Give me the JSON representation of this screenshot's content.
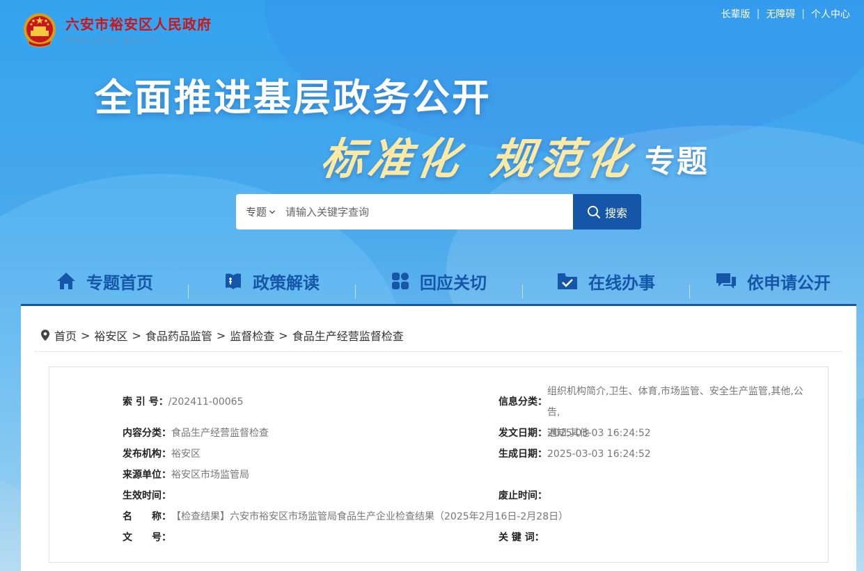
{
  "header": {
    "site_title": "六安市裕安区人民政府",
    "site_url": "www.yuan.gov.cn",
    "links": [
      "长辈版",
      "无障碍",
      "个人中心"
    ],
    "separator": "|"
  },
  "banner": {
    "headline": "全面推进基层政务公开",
    "calligraphy_1": "标准化",
    "calligraphy_2": "规范化",
    "suffix": "专题"
  },
  "search": {
    "scope_label": "专题",
    "placeholder": "请输入关键字查询",
    "button_label": "搜索"
  },
  "nav": {
    "items": [
      {
        "label": "专题首页",
        "icon": "home-icon"
      },
      {
        "label": "政策解读",
        "icon": "book-icon"
      },
      {
        "label": "回应关切",
        "icon": "grid-icon"
      },
      {
        "label": "在线办事",
        "icon": "folder-check-icon"
      },
      {
        "label": "依申请公开",
        "icon": "chat-icon"
      }
    ]
  },
  "breadcrumb": {
    "items": [
      "首页",
      "裕安区",
      "食品药品监管",
      "监督检查",
      "食品生产经营监督检查"
    ],
    "separator": ">"
  },
  "info": {
    "index_no": {
      "label": "索 引 号：",
      "value": "/202411-00065"
    },
    "category": {
      "label": "信息分类：",
      "value_line1": "组织机构简介,卫生、体育,市场监管、安全生产监管,其他,公告,",
      "value_line2": "通知,其他"
    },
    "content_type": {
      "label": "内容分类：",
      "value": "食品生产经营监督检查"
    },
    "issue_date": {
      "label": "发文日期：",
      "value": "2025-03-03 16:24:52"
    },
    "publisher": {
      "label": "发布机构：",
      "value": "裕安区"
    },
    "generated_date": {
      "label": "生成日期：",
      "value": "2025-03-03 16:24:52"
    },
    "source": {
      "label": "来源单位：",
      "value": "裕安区市场监管局"
    },
    "effective_time": {
      "label": "生效时间：",
      "value": ""
    },
    "expiry_time": {
      "label": "废止时间：",
      "value": ""
    },
    "name": {
      "label": "名　　称：",
      "value": "【检查结果】六安市裕安区市场监管局食品生产企业检查结果（2025年2月16日-2月28日）"
    },
    "doc_no": {
      "label": "文　　号：",
      "value": ""
    },
    "keywords": {
      "label": "关 键 词：",
      "value": ""
    }
  },
  "colors": {
    "brand_red": "#c8161d",
    "nav_blue": "#1556a8",
    "banner_blue": "#33a3ee",
    "calligraphy_gold": "#fbe9a4"
  }
}
